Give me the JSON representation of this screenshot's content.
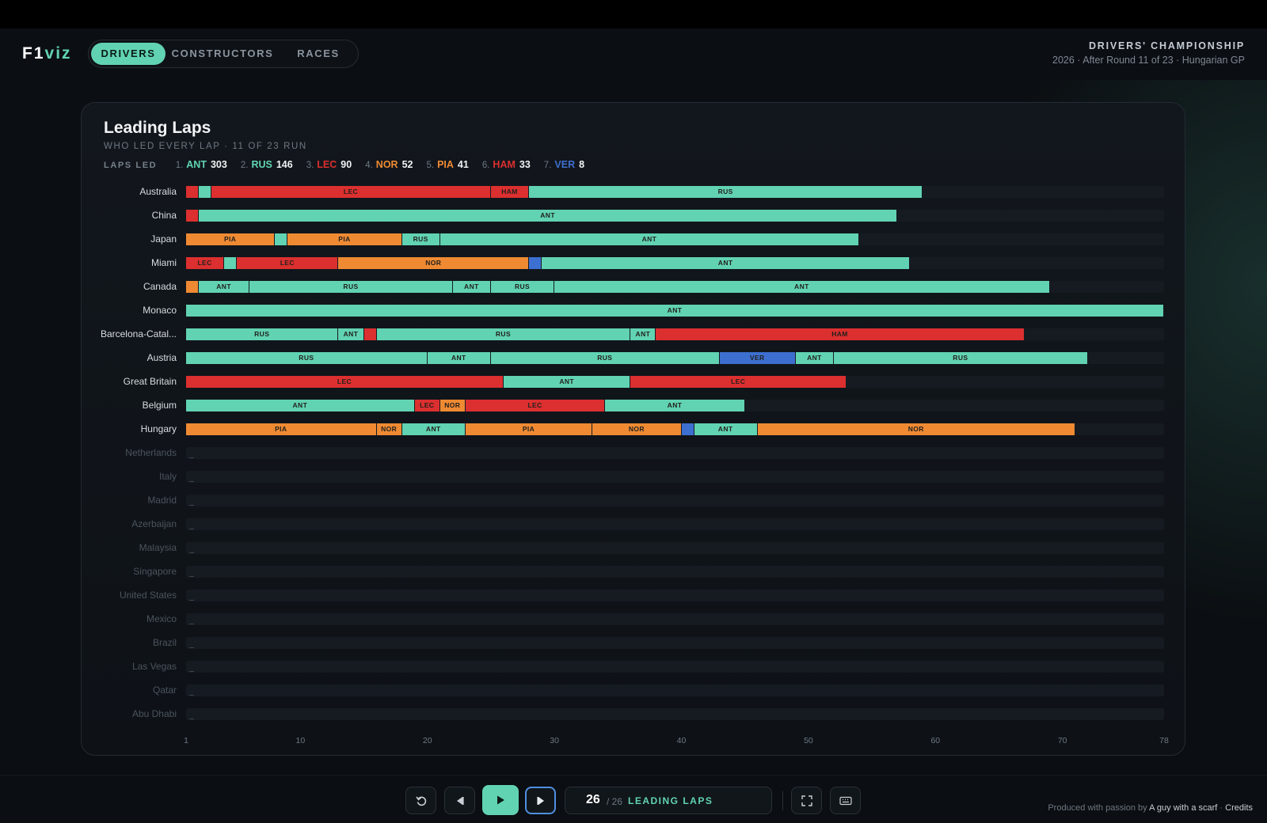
{
  "app": {
    "logo_a": "F1",
    "logo_b": "viz"
  },
  "nav": {
    "tabs": [
      {
        "label": "DRIVERS",
        "active": true
      },
      {
        "label": "CONSTRUCTORS",
        "active": false
      },
      {
        "label": "RACES",
        "active": false
      }
    ]
  },
  "header_right": {
    "title": "DRIVERS' CHAMPIONSHIP",
    "subtitle": "2026 · After Round 11 of 23 · Hungarian GP"
  },
  "card": {
    "title": "Leading Laps",
    "subtitle": "WHO LED EVERY LAP · 11 OF 23 RUN",
    "legend_label": "LAPS LED",
    "legend": [
      {
        "rank": "1.",
        "code": "ANT",
        "laps": "303"
      },
      {
        "rank": "2.",
        "code": "RUS",
        "laps": "146"
      },
      {
        "rank": "3.",
        "code": "LEC",
        "laps": "90"
      },
      {
        "rank": "4.",
        "code": "NOR",
        "laps": "52"
      },
      {
        "rank": "5.",
        "code": "PIA",
        "laps": "41"
      },
      {
        "rank": "6.",
        "code": "HAM",
        "laps": "33"
      },
      {
        "rank": "7.",
        "code": "VER",
        "laps": "8"
      }
    ]
  },
  "colors": {
    "ANT": "#61d3b2",
    "RUS": "#61d3b2",
    "LEC": "#dc2f2f",
    "HAM": "#dc2f2f",
    "NOR": "#ef8a33",
    "PIA": "#ef8a33",
    "VER": "#3d6fd0",
    "accent": "#61d3b2",
    "track": "#161b22"
  },
  "chart_data": {
    "type": "bar",
    "title": "Leading Laps",
    "xlabel": "Lap",
    "xlim": [
      1,
      78
    ],
    "x_ticks": [
      "1",
      "10",
      "20",
      "30",
      "40",
      "50",
      "60",
      "70",
      "78"
    ],
    "races": [
      {
        "name": "Australia",
        "segments": [
          [
            "LEC",
            1,
            2
          ],
          [
            "ANT",
            2,
            3
          ],
          [
            "LEC",
            3,
            25
          ],
          [
            "HAM",
            25,
            28
          ],
          [
            "RUS",
            28,
            59
          ]
        ]
      },
      {
        "name": "China",
        "segments": [
          [
            "LEC",
            1,
            2
          ],
          [
            "ANT",
            2,
            57
          ]
        ]
      },
      {
        "name": "Japan",
        "segments": [
          [
            "PIA",
            1,
            8
          ],
          [
            "ANT",
            8,
            9
          ],
          [
            "PIA",
            9,
            18
          ],
          [
            "RUS",
            18,
            21
          ],
          [
            "ANT",
            21,
            54
          ]
        ]
      },
      {
        "name": "Miami",
        "segments": [
          [
            "LEC",
            1,
            4
          ],
          [
            "ANT",
            4,
            5
          ],
          [
            "LEC",
            5,
            13
          ],
          [
            "NOR",
            13,
            28
          ],
          [
            "VER",
            28,
            29
          ],
          [
            "ANT",
            29,
            58
          ]
        ]
      },
      {
        "name": "Canada",
        "segments": [
          [
            "NOR",
            1,
            2
          ],
          [
            "ANT",
            2,
            6
          ],
          [
            "RUS",
            6,
            22
          ],
          [
            "ANT",
            22,
            25
          ],
          [
            "RUS",
            25,
            30
          ],
          [
            "ANT",
            30,
            69
          ]
        ]
      },
      {
        "name": "Monaco",
        "segments": [
          [
            "ANT",
            1,
            78
          ]
        ]
      },
      {
        "name": "Barcelona-Catal...",
        "segments": [
          [
            "RUS",
            1,
            13
          ],
          [
            "ANT",
            13,
            15
          ],
          [
            "LEC",
            15,
            16
          ],
          [
            "RUS",
            16,
            36
          ],
          [
            "ANT",
            36,
            38
          ],
          [
            "HAM",
            38,
            67
          ]
        ]
      },
      {
        "name": "Austria",
        "segments": [
          [
            "RUS",
            1,
            20
          ],
          [
            "ANT",
            20,
            25
          ],
          [
            "RUS",
            25,
            43
          ],
          [
            "VER",
            43,
            49
          ],
          [
            "ANT",
            49,
            52
          ],
          [
            "RUS",
            52,
            72
          ]
        ]
      },
      {
        "name": "Great Britain",
        "segments": [
          [
            "LEC",
            1,
            26
          ],
          [
            "ANT",
            26,
            36
          ],
          [
            "LEC",
            36,
            53
          ]
        ]
      },
      {
        "name": "Belgium",
        "segments": [
          [
            "ANT",
            1,
            19
          ],
          [
            "LEC",
            19,
            21
          ],
          [
            "NOR",
            21,
            23
          ],
          [
            "LEC",
            23,
            34
          ],
          [
            "ANT",
            34,
            45
          ]
        ]
      },
      {
        "name": "Hungary",
        "segments": [
          [
            "PIA",
            1,
            16
          ],
          [
            "NOR",
            16,
            18
          ],
          [
            "ANT",
            18,
            23
          ],
          [
            "PIA",
            23,
            33
          ],
          [
            "NOR",
            33,
            40
          ],
          [
            "VER",
            40,
            41
          ],
          [
            "ANT",
            41,
            46
          ],
          [
            "NOR",
            46,
            71
          ]
        ]
      },
      {
        "name": "Netherlands",
        "segments": []
      },
      {
        "name": "Italy",
        "segments": []
      },
      {
        "name": "Madrid",
        "segments": []
      },
      {
        "name": "Azerbaijan",
        "segments": []
      },
      {
        "name": "Malaysia",
        "segments": []
      },
      {
        "name": "Singapore",
        "segments": []
      },
      {
        "name": "United States",
        "segments": []
      },
      {
        "name": "Mexico",
        "segments": []
      },
      {
        "name": "Brazil",
        "segments": []
      },
      {
        "name": "Las Vegas",
        "segments": []
      },
      {
        "name": "Qatar",
        "segments": []
      },
      {
        "name": "Abu Dhabi",
        "segments": []
      }
    ]
  },
  "controls": {
    "current": "26",
    "total": "/ 26",
    "label": "LEADING LAPS"
  },
  "credit": {
    "prefix": "Produced with passion by",
    "author": "A guy with a scarf",
    "sep": "·",
    "link": "Credits"
  }
}
